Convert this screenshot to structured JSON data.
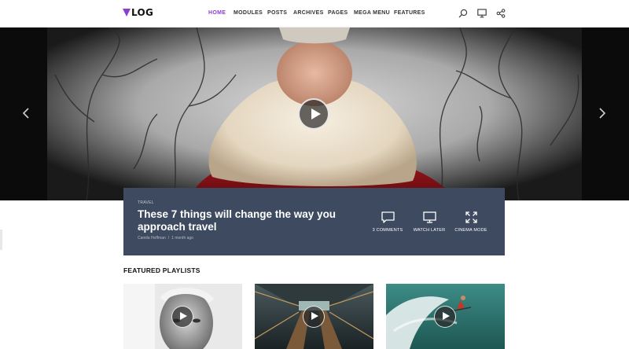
{
  "brand": {
    "logo_text": "LOG",
    "accent_color": "#8a3fd1"
  },
  "nav": {
    "items": [
      {
        "label": "HOME",
        "active": true
      },
      {
        "label": "MODULES",
        "active": false
      },
      {
        "label": "POSTS",
        "active": false
      },
      {
        "label": "ARCHIVES",
        "active": false
      },
      {
        "label": "PAGES",
        "active": false
      },
      {
        "label": "MEGA MENU",
        "active": false
      },
      {
        "label": "FEATURES",
        "active": false
      }
    ],
    "icons": [
      "search-icon",
      "monitor-icon",
      "share-icon"
    ]
  },
  "hero": {
    "icons": [
      "chevron-left-icon",
      "play-icon",
      "chevron-right-icon"
    ]
  },
  "featured_post": {
    "category": "TRAVEL",
    "title": "These 7 things will change the way you approach travel",
    "author": "Camila Hoffman",
    "separator": "/",
    "date": "1 month ago",
    "panel_color": "#3d4a5f",
    "actions": [
      {
        "label": "3 COMMENTS",
        "icon": "comment-icon"
      },
      {
        "label": "WATCH LATER",
        "icon": "monitor-icon"
      },
      {
        "label": "CINEMA MODE",
        "icon": "expand-icon"
      }
    ]
  },
  "featured_playlists": {
    "title": "FEATURED PLAYLISTS",
    "cards": [
      {
        "icon": "play-icon"
      },
      {
        "icon": "play-icon"
      },
      {
        "icon": "play-icon"
      }
    ]
  }
}
